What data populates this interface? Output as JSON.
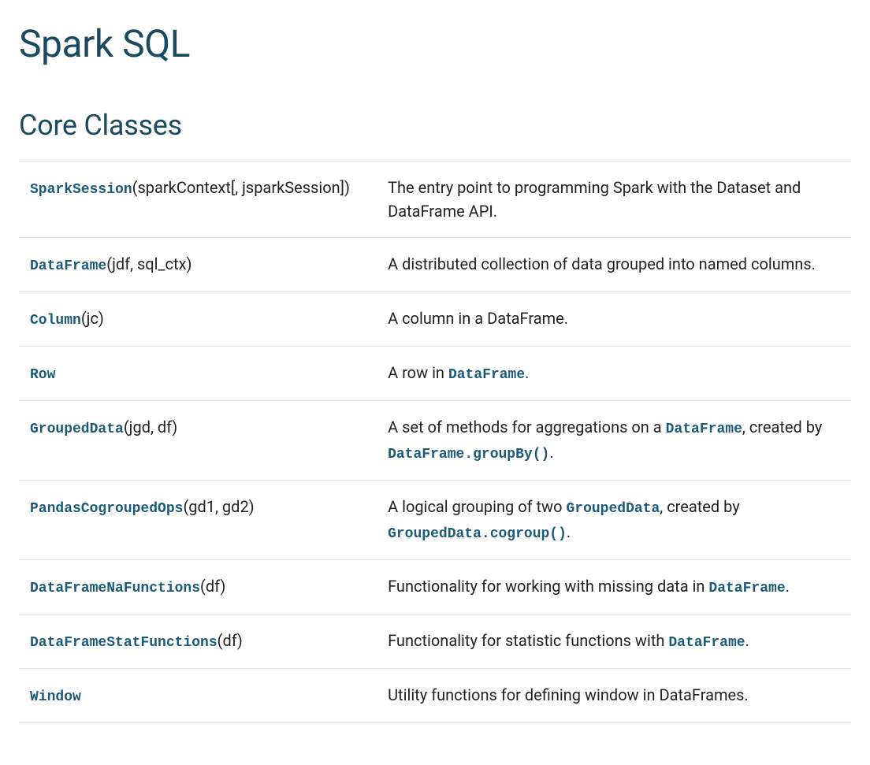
{
  "page_title": "Spark SQL",
  "section_title": "Core Classes",
  "rows": [
    {
      "class": "SparkSession",
      "params": "(sparkContext[, jsparkSession])",
      "desc": [
        {
          "t": "text",
          "v": "The entry point to programming Spark with the Dataset and DataFrame API."
        }
      ]
    },
    {
      "class": "DataFrame",
      "params": "(jdf, sql_ctx)",
      "desc": [
        {
          "t": "text",
          "v": "A distributed collection of data grouped into named columns."
        }
      ]
    },
    {
      "class": "Column",
      "params": "(jc)",
      "desc": [
        {
          "t": "text",
          "v": "A column in a DataFrame."
        }
      ]
    },
    {
      "class": "Row",
      "params": "",
      "desc": [
        {
          "t": "text",
          "v": "A row in "
        },
        {
          "t": "link",
          "v": "DataFrame"
        },
        {
          "t": "text",
          "v": "."
        }
      ]
    },
    {
      "class": "GroupedData",
      "params": "(jgd, df)",
      "desc": [
        {
          "t": "text",
          "v": "A set of methods for aggregations on a "
        },
        {
          "t": "link",
          "v": "DataFrame"
        },
        {
          "t": "text",
          "v": ", created by "
        },
        {
          "t": "link",
          "v": "DataFrame.groupBy()"
        },
        {
          "t": "text",
          "v": "."
        }
      ]
    },
    {
      "class": "PandasCogroupedOps",
      "params": "(gd1, gd2)",
      "desc": [
        {
          "t": "text",
          "v": "A logical grouping of two "
        },
        {
          "t": "link",
          "v": "GroupedData"
        },
        {
          "t": "text",
          "v": ", created by "
        },
        {
          "t": "link",
          "v": "GroupedData.cogroup()"
        },
        {
          "t": "text",
          "v": "."
        }
      ]
    },
    {
      "class": "DataFrameNaFunctions",
      "params": "(df)",
      "desc": [
        {
          "t": "text",
          "v": "Functionality for working with missing data in "
        },
        {
          "t": "link",
          "v": "DataFrame"
        },
        {
          "t": "text",
          "v": "."
        }
      ]
    },
    {
      "class": "DataFrameStatFunctions",
      "params": "(df)",
      "desc": [
        {
          "t": "text",
          "v": "Functionality for statistic functions with "
        },
        {
          "t": "link",
          "v": "DataFrame"
        },
        {
          "t": "text",
          "v": "."
        }
      ]
    },
    {
      "class": "Window",
      "params": "",
      "desc": [
        {
          "t": "text",
          "v": "Utility functions for defining window in DataFrames."
        }
      ]
    }
  ]
}
